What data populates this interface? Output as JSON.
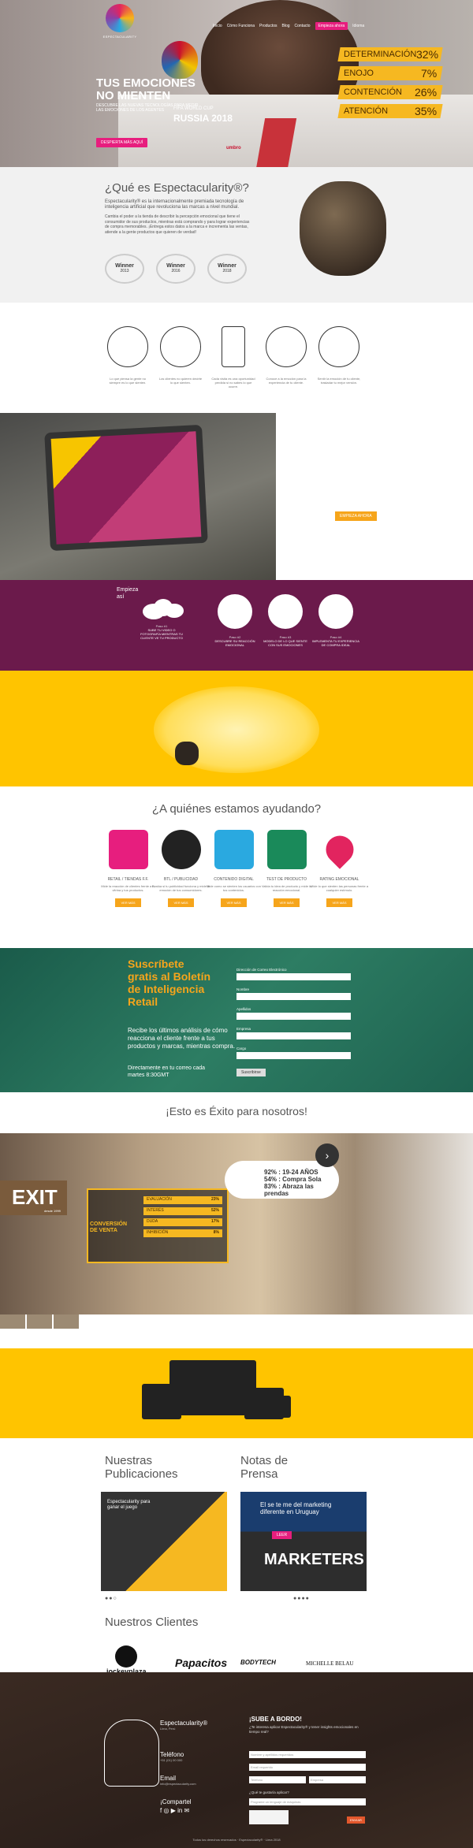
{
  "brand": {
    "logo_text": "ESPECTACULARITY"
  },
  "nav": {
    "items": [
      "Inicio",
      "Cómo Funciona",
      "Productos",
      "Blog",
      "Contacto"
    ],
    "cta": "Empieza ahora",
    "lang": "Idioma"
  },
  "hero": {
    "title_line1": "TUS EMOCIONES",
    "title_line2": "NO MIENTEN",
    "sub": "DESCUBRE LAS NUEVAS TECNOLOGÍAS PARA MEDIR LAS EMOCIONES DE LOS AGENTES",
    "button": "DESPIERTA MÁS AQUÍ",
    "worldcup": "FIFA WORLD CUP",
    "russia": "RUSSIA 2018",
    "umbro": "umbro",
    "metrics": [
      {
        "label": "DETERMINACIÓN",
        "value": "32%"
      },
      {
        "label": "ENOJO",
        "value": "7%"
      },
      {
        "label": "CONTENCIÓN",
        "value": "26%"
      },
      {
        "label": "ATENCIÓN",
        "value": "35%"
      }
    ]
  },
  "quees": {
    "title": "¿Qué es Espectacularity®?",
    "p1": "Espectacularity® es la internacionalmente premiada tecnología de inteligencia artificial que revoluciona las marcas a nivel mundial.",
    "p2": "Cambia el poder a la tienda de describir la percepción emocional que tiene el consumidor de sus productos, mientras está comprando y para lograr experiencias de compra memorables. ¡Entrega estos datos a la marca e incrementa las ventas, atiende a la gente productos que quieren de verdad!",
    "awards": [
      {
        "title": "Winner",
        "sub": "Business Plan Competition",
        "year": "2013"
      },
      {
        "title": "Winner",
        "sub": "Business Plan Competition",
        "year": "2016"
      },
      {
        "title": "Winner",
        "sub": "Business Plan Competition",
        "year": "2018"
      }
    ]
  },
  "icons": [
    {
      "name": "face",
      "text": "Lo que piensa la gente no siempre es lo que sienten."
    },
    {
      "name": "nocrowd",
      "text": "Los clientes no quieren decirte lo que sienten."
    },
    {
      "name": "phone",
      "text": "Cada visita es una oportunidad perdida si no sabes lo que ocurre."
    },
    {
      "name": "group",
      "text": "Conoce a la emoción para la experiencia de tu cliente."
    },
    {
      "name": "heart",
      "text": "Sentir la emoción de tu cliente, trasladar tu mejor versión."
    }
  ],
  "tablet": {
    "button": "EMPIEZA AHORA"
  },
  "steps": {
    "title": "Empieza así",
    "items": [
      {
        "n": "Paso #1",
        "t": "SUBE TU VIDEO O FOTOGRAFÍA MIENTRAS TU CLIENTE VE TU PRODUCTO"
      },
      {
        "n": "Paso #2",
        "t": "DESCUBRE SU REACCIÓN EMOCIONAL"
      },
      {
        "n": "Paso #3",
        "t": "MODELO DE LO QUE SIENTE CON SUS EMOCIONES"
      },
      {
        "n": "Paso #4",
        "t": "IMPLEMENTA TU EXPERIENCIA DE COMPRA IDEAL"
      }
    ]
  },
  "quienes": {
    "title": "¿A quiénes estamos ayudando?",
    "button": "VER MÁS",
    "items": [
      {
        "title": "RETAIL / TIENDAS F.F.",
        "text": "Mide la reacción de clientes frente a tu vitrina y tus productos."
      },
      {
        "title": "BTL / PUBLICIDAD",
        "text": "Evalúa si tu publicidad funciona y mide la emoción de tus consumidores."
      },
      {
        "title": "CONTENIDO DIGITAL",
        "text": "Mide como se sienten los usuarios con tus contenidos."
      },
      {
        "title": "TEST DE PRODUCTO",
        "text": "Valida tu idea de producto y mide la reacción emocional."
      },
      {
        "title": "RATING EMOCIONAL",
        "text": "Mide lo que sienten las personas frente a cualquier estímulo."
      }
    ]
  },
  "news": {
    "title_l1": "Suscríbete",
    "title_l2": "gratis al Boletín",
    "title_l3": "de Inteligencia",
    "title_l4": "Retail",
    "p": "Recibe los últimos análisis de cómo reacciona el cliente frente a tus productos y marcas, mientras compra.",
    "p2": "Directamente en tu correo cada martes 8:30GMT",
    "fields": [
      "Dirección de Correo Electrónico",
      "Nombre",
      "Apellidos",
      "Empresa",
      "Cargo"
    ],
    "button": "Suscribirse"
  },
  "exito": {
    "title": "¡Esto es Éxito para nosotros!",
    "logo": "EXIT",
    "logo_sub": "desde 1999",
    "conv_l1": "CONVERSIÓN",
    "conv_l2": "DE VENTA",
    "rows": [
      {
        "k": "EVALUACIÓN",
        "v": "23%"
      },
      {
        "k": "INTERÉS",
        "v": "52%"
      },
      {
        "k": "DUDA",
        "v": "17%"
      },
      {
        "k": "INHIBICIÓN",
        "v": "8%"
      }
    ],
    "demo": [
      "92% : 19-24 AÑOS",
      "54% : Compra Sola",
      "83% : Abraza las prendas"
    ]
  },
  "pubs": {
    "t1": "Nuestras",
    "t2": "Publicaciones",
    "t3": "Notas de",
    "t4": "Prensa",
    "card1": "Espectacularity para ganar el juego",
    "card2": "El se te me del marketing diferente en Uruguay",
    "card2_btn": "LEER",
    "marketers": "MARKETERS"
  },
  "clients": {
    "title": "Nuestros Clientes",
    "items": [
      "jockeyplaza",
      "Papacitos",
      "BODYTECH",
      "MICHELLE BELAU"
    ]
  },
  "footer": {
    "brand": "Espectacularity®",
    "brand_sub": "Lima, Perú",
    "tel_label": "Teléfono",
    "tel": "+51 (01) 00 000",
    "email_label": "Email",
    "email": "info@espectacularity.com",
    "share": "¡Compartel",
    "sub_title": "¡SUBE A BORDO!",
    "sub_p": "¿Te interesa aplicar Espectacularity® y tener insights emocionales en tiempo real?",
    "inputs": [
      "Nombre y apellidos requeridos",
      "Email requerido",
      "Teléfono",
      "Empresa"
    ],
    "select_q": "¿Qué te gustaría aplicar?",
    "select": "Programe un lenguaje de máquinas",
    "send": "ENVIAR",
    "copy": "Todos los derechos reservados · Espectacularity® · Lima 2018"
  }
}
